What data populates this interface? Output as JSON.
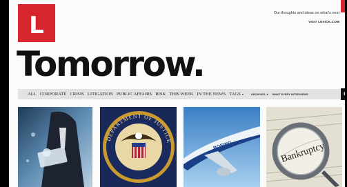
{
  "brand": {
    "logo_letter": "L",
    "wordmark": "Tomorrow.",
    "accent_color": "#d8262e"
  },
  "header": {
    "tagline": "Our thoughts and ideas on what's next",
    "visit_link": "VISIT LEVICK.COM"
  },
  "nav": {
    "items": [
      "ALL",
      "CORPORATE",
      "CRISIS",
      "LITIGATION",
      "PUBLIC AFFAIRS",
      "RISK",
      "THIS WEEK",
      "IN THE NEWS",
      "TAGS"
    ],
    "extra_items": [
      "ARCHIVES",
      "WHAT EVERY INTERVIEWS"
    ],
    "search_icon": "search-icon"
  },
  "articles": [
    {
      "image": "businessman-tablet-image"
    },
    {
      "image": "department-of-justice-seal-image",
      "seal_text": "DEPARTMENT OF JUSTICE"
    },
    {
      "image": "boeing-airplane-image",
      "plane_text": "BOEING"
    },
    {
      "image": "bankruptcy-magnifier-image",
      "paper_text": "Bankruptcy"
    }
  ]
}
